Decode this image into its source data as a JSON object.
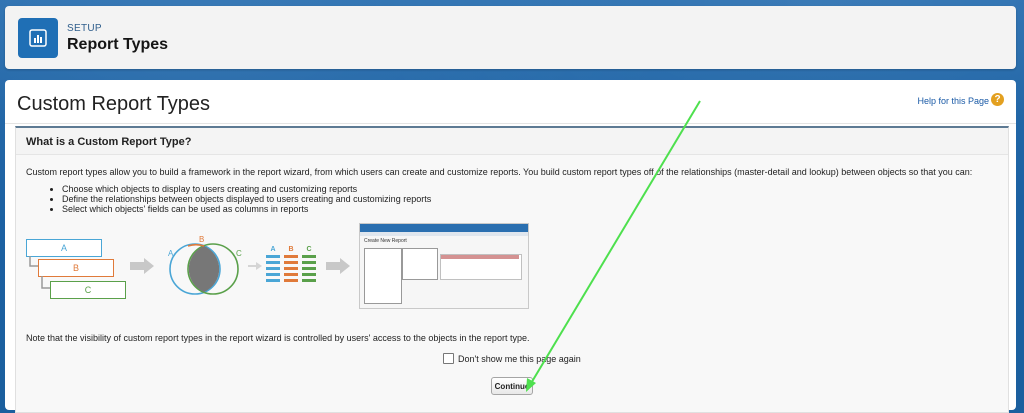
{
  "header": {
    "eyebrow": "SETUP",
    "title": "Report Types",
    "icon": "report-chart-icon"
  },
  "page": {
    "title": "Custom Report Types",
    "help_link": "Help for this Page"
  },
  "section": {
    "title": "What is a Custom Report Type?",
    "intro": "Custom report types allow you to build a framework in the report wizard, from which users can create and customize reports. You build custom report types off of the relationships (master-detail and lookup) between objects so that you can:",
    "bullets": [
      "Choose which objects to display to users creating and customizing reports",
      "Define the relationships between objects displayed to users creating and customizing reports",
      "Select which objects' fields can be used as columns in reports"
    ],
    "diagram": {
      "boxes": [
        "A",
        "B",
        "C"
      ],
      "venn": [
        "A",
        "B",
        "C"
      ],
      "columns": [
        "A",
        "B",
        "C"
      ],
      "colors": {
        "a": "#4aa6d6",
        "b": "#e07a3a",
        "c": "#5aa04a"
      },
      "screenshot_caption": "Create New Report"
    },
    "note": "Note that the visibility of custom report types in the report wizard is controlled by users' access to the objects in the report type.",
    "checkbox_label": "Don't show me this page again",
    "continue_label": "Continue"
  }
}
